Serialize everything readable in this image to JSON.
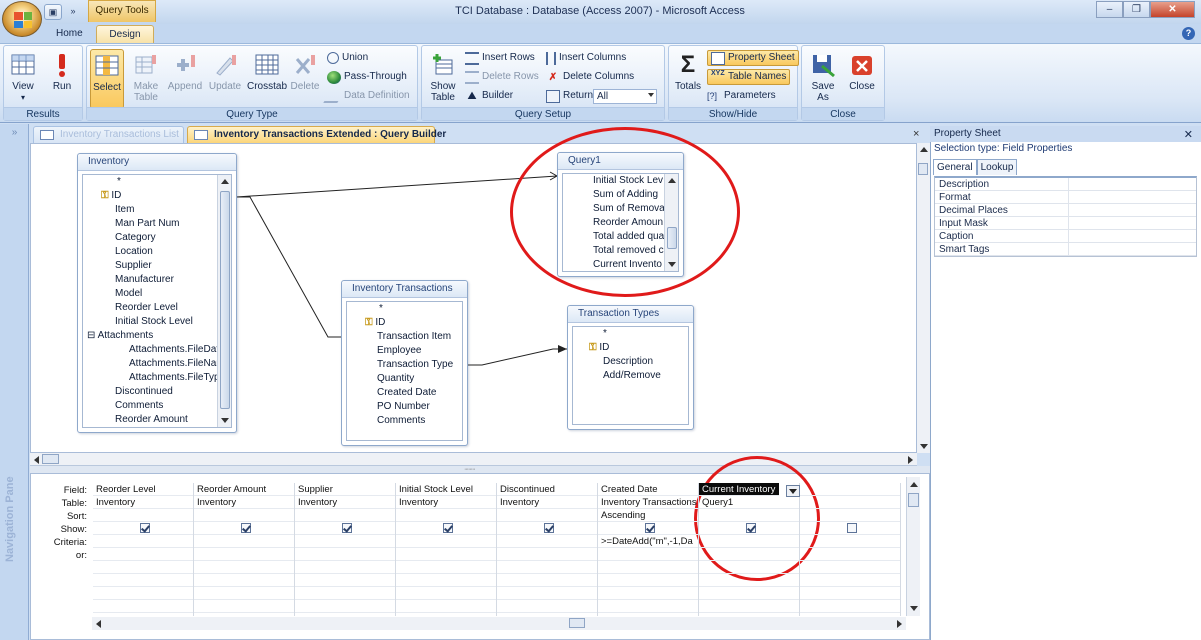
{
  "window": {
    "title": "TCI Database : Database (Access 2007) - Microsoft Access",
    "context_tab": "Query Tools",
    "help": "?"
  },
  "ribbon": {
    "tabs": [
      "Home",
      "Design"
    ],
    "groups": {
      "results": {
        "label": "Results",
        "buttons": [
          "View",
          "Run"
        ]
      },
      "query_type": {
        "label": "Query Type",
        "buttons": [
          "Select",
          "Make Table",
          "Append",
          "Update",
          "Crosstab",
          "Delete"
        ],
        "small": [
          "Union",
          "Pass-Through",
          "Data Definition"
        ]
      },
      "query_setup": {
        "label": "Query Setup",
        "show_table": "Show Table",
        "small": [
          "Insert Rows",
          "Delete Rows",
          "Builder",
          "Insert Columns",
          "Delete Columns",
          "Return:"
        ],
        "return_value": "All"
      },
      "show_hide": {
        "label": "Show/Hide",
        "totals": "Totals",
        "small": [
          "Property Sheet",
          "Table Names",
          "Parameters"
        ]
      },
      "close": {
        "label": "Close",
        "buttons": [
          "Save As",
          "Close"
        ]
      }
    }
  },
  "nav": {
    "label": "Navigation Pane",
    "chevron": "»"
  },
  "doc_tabs": [
    "Inventory Transactions List",
    "Inventory Transactions Extended : Query Builder"
  ],
  "doc_close": "×",
  "tables": {
    "inventory": {
      "title": "Inventory",
      "fields": [
        "*",
        "ID",
        "Item",
        "Man Part Num",
        "Category",
        "Location",
        "Supplier",
        "Manufacturer",
        "Model",
        "Reorder Level",
        "Initial Stock Level",
        "Attachments",
        "Attachments.FileDat",
        "Attachments.FileNar",
        "Attachments.FileTyp",
        "Discontinued",
        "Comments",
        "Reorder Amount"
      ]
    },
    "query1": {
      "title": "Query1",
      "fields": [
        "Initial Stock Lev",
        "Sum of Adding",
        "Sum of Remova",
        "Reorder Amoun",
        "Total added qua",
        "Total removed c",
        "Current Invento"
      ]
    },
    "inv_trans": {
      "title": "Inventory Transactions",
      "fields": [
        "*",
        "ID",
        "Transaction Item",
        "Employee",
        "Transaction Type",
        "Quantity",
        "Created Date",
        "PO Number",
        "Comments"
      ]
    },
    "trans_types": {
      "title": "Transaction Types",
      "fields": [
        "*",
        "ID",
        "Description",
        "Add/Remove"
      ]
    }
  },
  "grid": {
    "row_labels": [
      "Field:",
      "Table:",
      "Sort:",
      "Show:",
      "Criteria:",
      "or:"
    ],
    "columns": [
      {
        "field": "Reorder Level",
        "table": "Inventory",
        "sort": "",
        "show": true,
        "criteria": ""
      },
      {
        "field": "Reorder Amount",
        "table": "Inventory",
        "sort": "",
        "show": true,
        "criteria": ""
      },
      {
        "field": "Supplier",
        "table": "Inventory",
        "sort": "",
        "show": true,
        "criteria": ""
      },
      {
        "field": "Initial Stock Level",
        "table": "Inventory",
        "sort": "",
        "show": true,
        "criteria": ""
      },
      {
        "field": "Discontinued",
        "table": "Inventory",
        "sort": "",
        "show": true,
        "criteria": ""
      },
      {
        "field": "Created Date",
        "table": "Inventory Transactions",
        "sort": "Ascending",
        "show": true,
        "criteria": ">=DateAdd(\"m\",-1,Da"
      },
      {
        "field": "Current Inventory",
        "table": "Query1",
        "sort": "",
        "show": true,
        "criteria": ""
      },
      {
        "field": "",
        "table": "",
        "sort": "",
        "show": false,
        "criteria": ""
      }
    ]
  },
  "property_sheet": {
    "title": "Property Sheet",
    "selection": "Selection type:  Field Properties",
    "tabs": [
      "General",
      "Lookup"
    ],
    "properties": [
      "Description",
      "Format",
      "Decimal Places",
      "Input Mask",
      "Caption",
      "Smart Tags"
    ]
  },
  "colors": {
    "annotation": "#e01a1a",
    "accent": "#f9c85d"
  }
}
